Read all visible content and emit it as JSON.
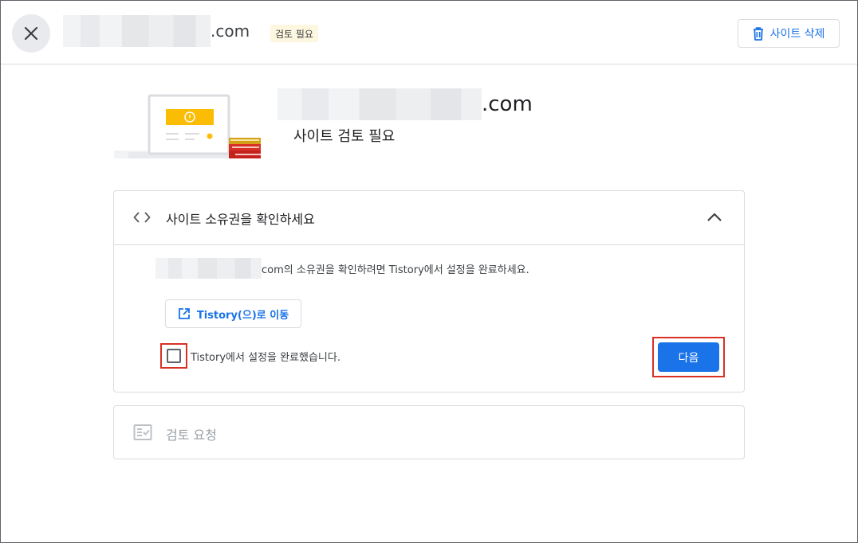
{
  "header": {
    "domain_suffix": ".com",
    "status_chip": "검토 필요",
    "delete_label": "사이트 삭제"
  },
  "site": {
    "domain_suffix": ".com",
    "status": "사이트 검토 필요"
  },
  "verify_card": {
    "title": "사이트 소유권을 확인하세요",
    "description_suffix": "com의 소유권을 확인하려면 Tistory에서 설정을 완료하세요.",
    "open_button": "Tistory(으)로 이동",
    "checkbox_label": "Tistory에서 설정을 완료했습니다.",
    "checkbox_checked": false,
    "next_button": "다음"
  },
  "review_card": {
    "title": "검토 요청"
  },
  "colors": {
    "accent": "#1a73e8",
    "highlight_border": "#d93025",
    "chip_bg": "#fef7e0",
    "warning": "#fbbc04"
  },
  "icons": {
    "close": "close-icon",
    "delete": "trash-icon",
    "code": "code-icon",
    "collapse": "chevron-up-icon",
    "open": "open-in-new-icon",
    "review": "fact-check-icon"
  }
}
